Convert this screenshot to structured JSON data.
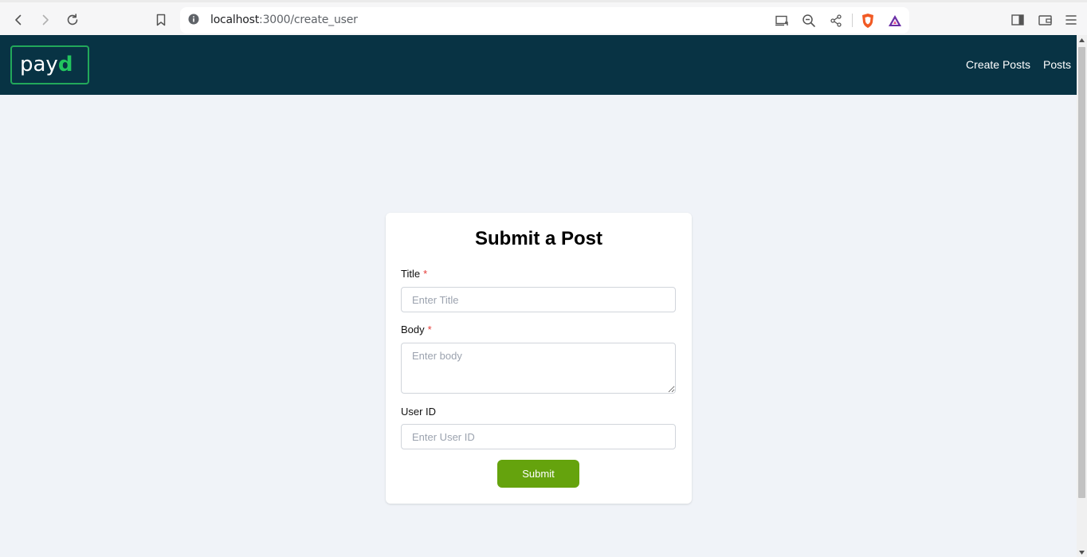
{
  "browser": {
    "url_host": "localhost",
    "url_path": ":3000/create_user",
    "icons": [
      "back-icon",
      "forward-icon",
      "reload-icon",
      "bookmark-icon",
      "info-icon",
      "cast-icon",
      "zoom-out-icon",
      "share-icon",
      "brave-shields-icon",
      "brave-rewards-icon",
      "sidebar-icon",
      "wallet-icon",
      "menu-icon"
    ]
  },
  "header": {
    "logo_text": "payd",
    "nav": [
      "Create Posts",
      "Posts"
    ]
  },
  "form": {
    "title": "Submit a Post",
    "fields": [
      {
        "label": "Title",
        "required_mark": "*",
        "placeholder": "Enter Title"
      },
      {
        "label": "Body",
        "required_mark": "*",
        "placeholder": "Enter body"
      },
      {
        "label": "User ID",
        "placeholder": "Enter User ID"
      }
    ],
    "submit_label": "Submit"
  },
  "colors": {
    "header_bg": "#083344",
    "page_bg": "#f0f3f8",
    "submit_bg": "#65a30d",
    "logo_accent": "#22c55e",
    "required": "#e53935"
  }
}
